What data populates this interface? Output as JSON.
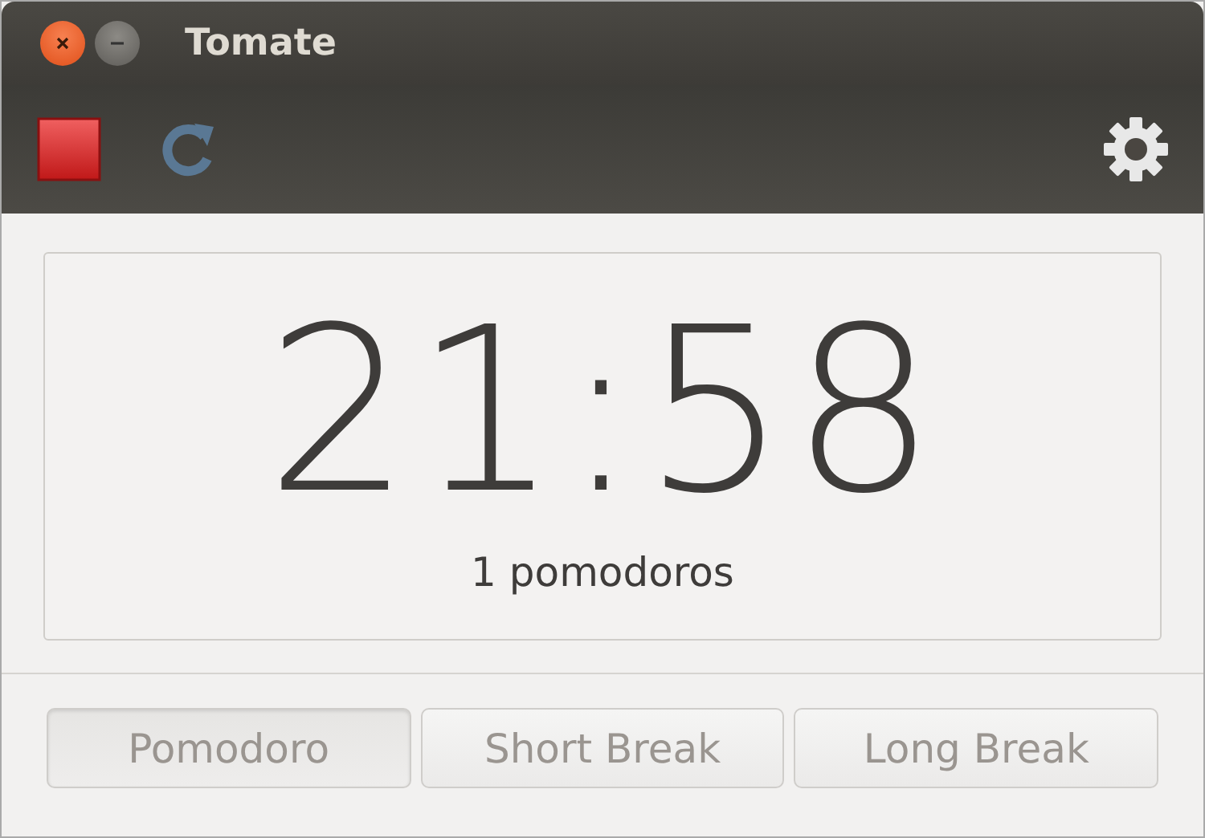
{
  "window": {
    "title": "Tomate"
  },
  "timer": {
    "time": "21:58",
    "count": "1 pomodoros"
  },
  "modes": [
    {
      "label": "Pomodoro",
      "selected": true,
      "disabled": true
    },
    {
      "label": "Short Break",
      "selected": false,
      "disabled": true
    },
    {
      "label": "Long Break",
      "selected": false,
      "disabled": true
    }
  ]
}
